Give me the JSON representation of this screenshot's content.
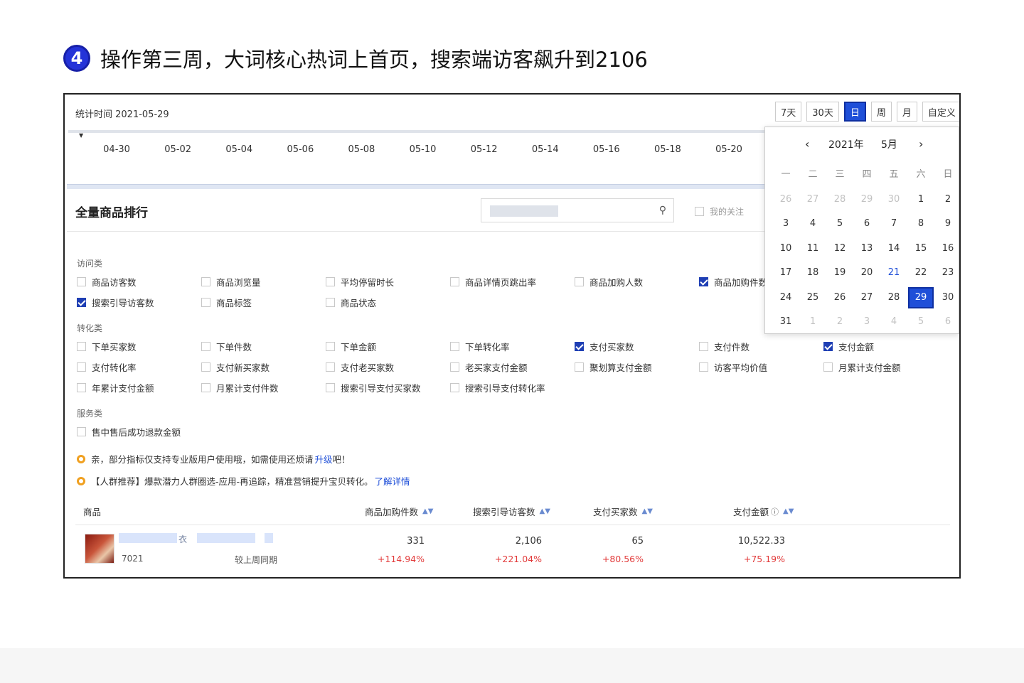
{
  "heading": {
    "step": "4",
    "text": "操作第三周，大词核心热词上首页，搜索端访客飙升到2106"
  },
  "stat_time": "统计时间 2021-05-29",
  "period_buttons": [
    {
      "label": "7天",
      "active": false
    },
    {
      "label": "30天",
      "active": false
    },
    {
      "label": "日",
      "active": true
    },
    {
      "label": "周",
      "active": false
    },
    {
      "label": "月",
      "active": false
    },
    {
      "label": "自定义",
      "active": false
    }
  ],
  "timeline_dates": [
    "04-30",
    "05-02",
    "05-04",
    "05-06",
    "05-08",
    "05-10",
    "05-12",
    "05-14",
    "05-16",
    "05-18",
    "05-20"
  ],
  "calendar": {
    "year": "2021年",
    "month": "5月",
    "weekdays": [
      "一",
      "二",
      "三",
      "四",
      "五",
      "六",
      "日"
    ],
    "weeks": [
      [
        {
          "d": "26",
          "o": true
        },
        {
          "d": "27",
          "o": true
        },
        {
          "d": "28",
          "o": true
        },
        {
          "d": "29",
          "o": true
        },
        {
          "d": "30",
          "o": true
        },
        {
          "d": "1"
        },
        {
          "d": "2"
        }
      ],
      [
        {
          "d": "3"
        },
        {
          "d": "4"
        },
        {
          "d": "5"
        },
        {
          "d": "6"
        },
        {
          "d": "7"
        },
        {
          "d": "8"
        },
        {
          "d": "9"
        }
      ],
      [
        {
          "d": "10"
        },
        {
          "d": "11"
        },
        {
          "d": "12"
        },
        {
          "d": "13"
        },
        {
          "d": "14"
        },
        {
          "d": "15"
        },
        {
          "d": "16"
        }
      ],
      [
        {
          "d": "17"
        },
        {
          "d": "18"
        },
        {
          "d": "19"
        },
        {
          "d": "20"
        },
        {
          "d": "21",
          "blue": true
        },
        {
          "d": "22"
        },
        {
          "d": "23"
        }
      ],
      [
        {
          "d": "24"
        },
        {
          "d": "25"
        },
        {
          "d": "26"
        },
        {
          "d": "27"
        },
        {
          "d": "28"
        },
        {
          "d": "29",
          "sel": true
        },
        {
          "d": "30"
        }
      ],
      [
        {
          "d": "31"
        },
        {
          "d": "1",
          "o": true
        },
        {
          "d": "2",
          "o": true
        },
        {
          "d": "3",
          "o": true
        },
        {
          "d": "4",
          "o": true
        },
        {
          "d": "5",
          "o": true
        },
        {
          "d": "6",
          "o": true
        }
      ]
    ]
  },
  "ranking": {
    "title": "全量商品排行",
    "follow_label": "我的关注"
  },
  "groups": {
    "visit": {
      "label": "访问类",
      "items": [
        {
          "label": "商品访客数",
          "checked": false
        },
        {
          "label": "商品浏览量",
          "checked": false
        },
        {
          "label": "平均停留时长",
          "checked": false
        },
        {
          "label": "商品详情页跳出率",
          "checked": false
        },
        {
          "label": "商品加购人数",
          "checked": false
        },
        {
          "label": "商品加购件数",
          "checked": true
        },
        {
          "label": "搜索引导访客数",
          "checked": true
        },
        {
          "label": "商品标签",
          "checked": false
        },
        {
          "label": "商品状态",
          "checked": false
        }
      ]
    },
    "convert": {
      "label": "转化类",
      "items": [
        {
          "label": "下单买家数",
          "checked": false
        },
        {
          "label": "下单件数",
          "checked": false
        },
        {
          "label": "下单金额",
          "checked": false
        },
        {
          "label": "下单转化率",
          "checked": false
        },
        {
          "label": "支付买家数",
          "checked": true
        },
        {
          "label": "支付件数",
          "checked": false
        },
        {
          "label": "支付金额",
          "checked": true
        },
        {
          "label": "支付转化率",
          "checked": false
        },
        {
          "label": "支付新买家数",
          "checked": false
        },
        {
          "label": "支付老买家数",
          "checked": false
        },
        {
          "label": "老买家支付金额",
          "checked": false
        },
        {
          "label": "聚划算支付金额",
          "checked": false
        },
        {
          "label": "访客平均价值",
          "checked": false
        },
        {
          "label": "月累计支付金额",
          "checked": false
        },
        {
          "label": "年累计支付金额",
          "checked": false
        },
        {
          "label": "月累计支付件数",
          "checked": false
        },
        {
          "label": "搜索引导支付买家数",
          "checked": false
        },
        {
          "label": "搜索引导支付转化率",
          "checked": false
        }
      ]
    },
    "service": {
      "label": "服务类",
      "items": [
        {
          "label": "售中售后成功退款金额",
          "checked": false
        }
      ]
    }
  },
  "tips": [
    {
      "text": "亲，部分指标仅支持专业版用户使用哦，如需使用还烦请",
      "link": "升级",
      "tail": "吧！"
    },
    {
      "text": "【人群推荐】爆款潜力人群圈选-应用-再追踪，精准营销提升宝贝转化。",
      "link": "了解详情",
      "tail": ""
    }
  ],
  "table": {
    "headers": [
      "商品",
      "商品加购件数",
      "搜索引导访客数",
      "支付买家数",
      "支付金额"
    ],
    "row": {
      "title_glyph": "衣",
      "id": "7021",
      "compare_label": "较上周同期",
      "values": [
        "331",
        "2,106",
        "65",
        "10,522.33"
      ],
      "changes": [
        "+114.94%",
        "+221.04%",
        "+80.56%",
        "+75.19%"
      ]
    }
  },
  "colors": {
    "accent": "#1f4fd8",
    "badge": "#2433d8",
    "increase": "#e23b3b",
    "tip": "#f0a020"
  }
}
